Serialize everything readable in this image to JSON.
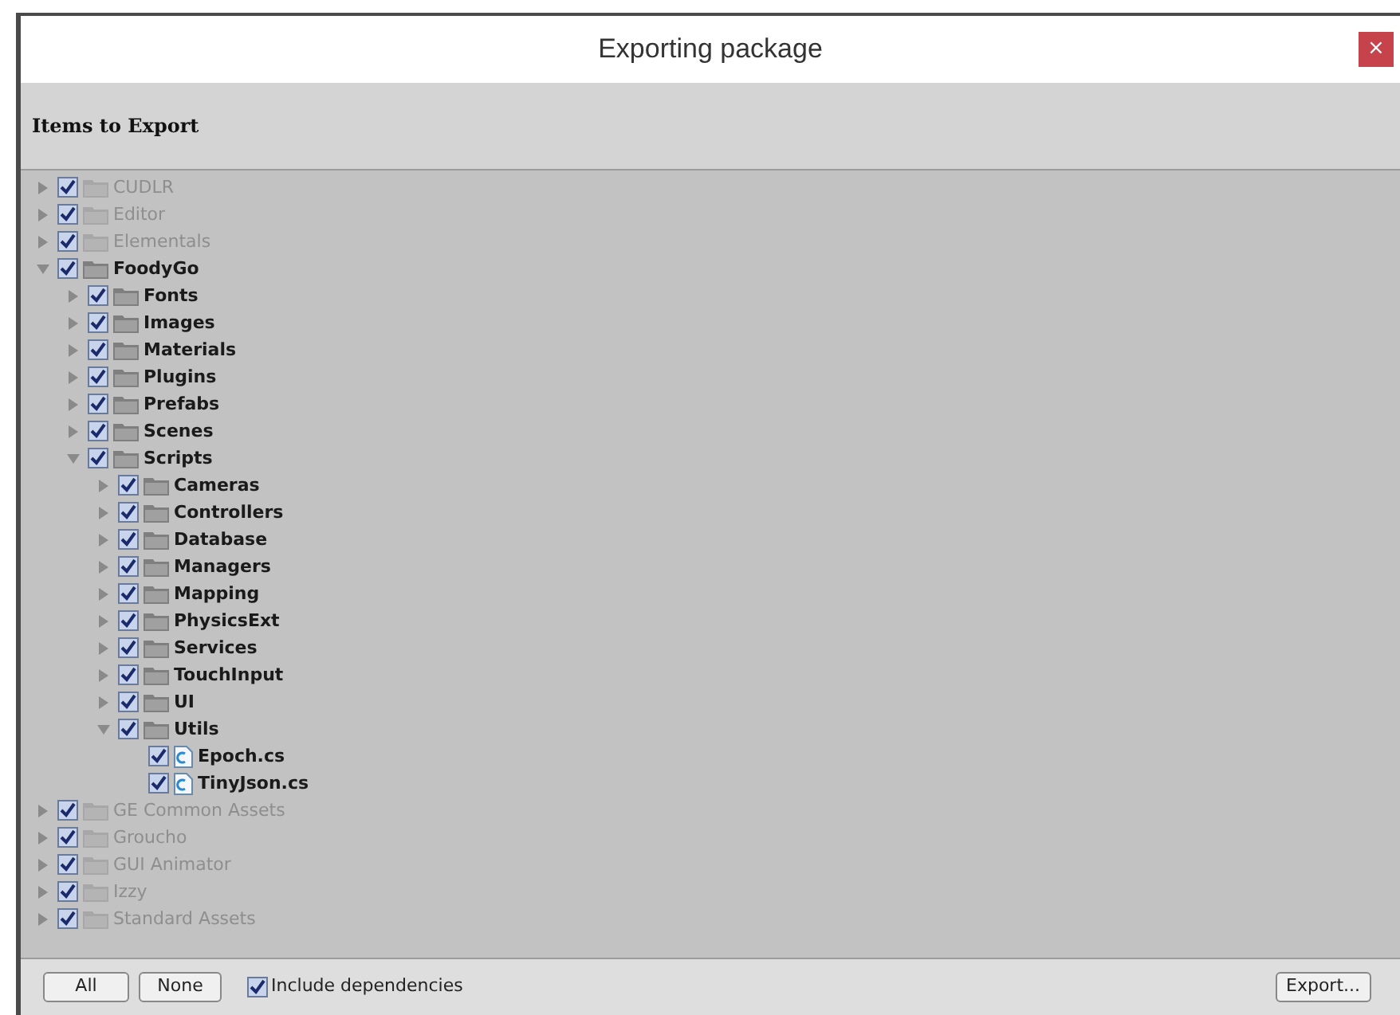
{
  "window": {
    "title": "Exporting package",
    "close": "×"
  },
  "header": {
    "title": "Items to Export"
  },
  "tree": [
    {
      "label": "CUDLR",
      "kind": "folder",
      "checked": true,
      "dimmed": true,
      "expanded": false
    },
    {
      "label": "Editor",
      "kind": "folder",
      "checked": true,
      "dimmed": true,
      "expanded": false
    },
    {
      "label": "Elementals",
      "kind": "folder",
      "checked": true,
      "dimmed": true,
      "expanded": false
    },
    {
      "label": "FoodyGo",
      "kind": "folder",
      "checked": true,
      "dimmed": false,
      "expanded": true,
      "children": [
        {
          "label": "Fonts",
          "kind": "folder",
          "checked": true,
          "dimmed": false,
          "expanded": false
        },
        {
          "label": "Images",
          "kind": "folder",
          "checked": true,
          "dimmed": false,
          "expanded": false
        },
        {
          "label": "Materials",
          "kind": "folder",
          "checked": true,
          "dimmed": false,
          "expanded": false
        },
        {
          "label": "Plugins",
          "kind": "folder",
          "checked": true,
          "dimmed": false,
          "expanded": false
        },
        {
          "label": "Prefabs",
          "kind": "folder",
          "checked": true,
          "dimmed": false,
          "expanded": false
        },
        {
          "label": "Scenes",
          "kind": "folder",
          "checked": true,
          "dimmed": false,
          "expanded": false
        },
        {
          "label": "Scripts",
          "kind": "folder",
          "checked": true,
          "dimmed": false,
          "expanded": true,
          "children": [
            {
              "label": "Cameras",
              "kind": "folder",
              "checked": true,
              "dimmed": false,
              "expanded": false
            },
            {
              "label": "Controllers",
              "kind": "folder",
              "checked": true,
              "dimmed": false,
              "expanded": false
            },
            {
              "label": "Database",
              "kind": "folder",
              "checked": true,
              "dimmed": false,
              "expanded": false
            },
            {
              "label": "Managers",
              "kind": "folder",
              "checked": true,
              "dimmed": false,
              "expanded": false
            },
            {
              "label": "Mapping",
              "kind": "folder",
              "checked": true,
              "dimmed": false,
              "expanded": false
            },
            {
              "label": "PhysicsExt",
              "kind": "folder",
              "checked": true,
              "dimmed": false,
              "expanded": false
            },
            {
              "label": "Services",
              "kind": "folder",
              "checked": true,
              "dimmed": false,
              "expanded": false
            },
            {
              "label": "TouchInput",
              "kind": "folder",
              "checked": true,
              "dimmed": false,
              "expanded": false
            },
            {
              "label": "UI",
              "kind": "folder",
              "checked": true,
              "dimmed": false,
              "expanded": false
            },
            {
              "label": "Utils",
              "kind": "folder",
              "checked": true,
              "dimmed": false,
              "expanded": true,
              "children": [
                {
                  "label": "Epoch.cs",
                  "kind": "file",
                  "checked": true,
                  "dimmed": false
                },
                {
                  "label": "TinyJson.cs",
                  "kind": "file",
                  "checked": true,
                  "dimmed": false
                }
              ]
            }
          ]
        }
      ]
    },
    {
      "label": "GE Common Assets",
      "kind": "folder",
      "checked": true,
      "dimmed": true,
      "expanded": false
    },
    {
      "label": "Groucho",
      "kind": "folder",
      "checked": true,
      "dimmed": true,
      "expanded": false
    },
    {
      "label": "GUI Animator",
      "kind": "folder",
      "checked": true,
      "dimmed": true,
      "expanded": false
    },
    {
      "label": "Izzy",
      "kind": "folder",
      "checked": true,
      "dimmed": true,
      "expanded": false
    },
    {
      "label": "Standard Assets",
      "kind": "folder",
      "checked": true,
      "dimmed": true,
      "expanded": false
    }
  ],
  "footer": {
    "buttons": [
      "All",
      "None"
    ],
    "include_dependencies": {
      "label": "Include dependencies",
      "checked": true
    },
    "export_button": "Export..."
  }
}
